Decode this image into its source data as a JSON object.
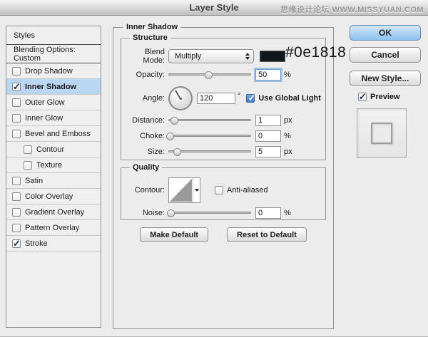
{
  "window": {
    "title": "Layer Style",
    "watermark": "思缘设计论坛 WWW.MISSYUAN.COM"
  },
  "annotation": {
    "color_hex": "#0e1818"
  },
  "sidebar": {
    "header": "Styles",
    "blending_options": "Blending Options: Custom",
    "items": [
      {
        "label": "Drop Shadow",
        "checked": false
      },
      {
        "label": "Inner Shadow",
        "checked": true,
        "selected": true
      },
      {
        "label": "Outer Glow",
        "checked": false
      },
      {
        "label": "Inner Glow",
        "checked": false
      },
      {
        "label": "Bevel and Emboss",
        "checked": false
      },
      {
        "label": "Contour",
        "checked": false,
        "indent": true
      },
      {
        "label": "Texture",
        "checked": false,
        "indent": true
      },
      {
        "label": "Satin",
        "checked": false
      },
      {
        "label": "Color Overlay",
        "checked": false
      },
      {
        "label": "Gradient Overlay",
        "checked": false
      },
      {
        "label": "Pattern Overlay",
        "checked": false
      },
      {
        "label": "Stroke",
        "checked": true
      }
    ]
  },
  "panel": {
    "title": "Inner Shadow",
    "structure": {
      "title": "Structure",
      "blend_mode": {
        "label": "Blend Mode:",
        "value": "Multiply",
        "swatch_color": "#0e1818"
      },
      "opacity": {
        "label": "Opacity:",
        "value": "50",
        "unit": "%",
        "percent": 48
      },
      "angle": {
        "label": "Angle:",
        "value": "120",
        "unit": "°",
        "use_global_light": "Use Global Light"
      },
      "distance": {
        "label": "Distance:",
        "value": "1",
        "unit": "px",
        "percent": 7
      },
      "choke": {
        "label": "Choke:",
        "value": "0",
        "unit": "%",
        "percent": 2
      },
      "size": {
        "label": "Size:",
        "value": "5",
        "unit": "px",
        "percent": 10
      }
    },
    "quality": {
      "title": "Quality",
      "contour": {
        "label": "Contour:",
        "anti_aliased": "Anti-aliased"
      },
      "noise": {
        "label": "Noise:",
        "value": "0",
        "unit": "%",
        "percent": 3
      }
    },
    "buttons": {
      "make_default": "Make Default",
      "reset_to_default": "Reset to Default"
    }
  },
  "actions": {
    "ok": "OK",
    "cancel": "Cancel",
    "new_style": "New Style...",
    "preview": "Preview"
  }
}
